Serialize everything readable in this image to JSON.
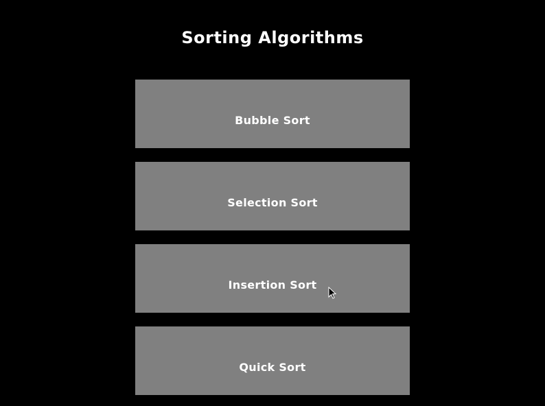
{
  "window": {
    "title": "Sorting Algorithms"
  },
  "menu": {
    "items": [
      {
        "label": "Bubble Sort"
      },
      {
        "label": "Selection Sort"
      },
      {
        "label": "Insertion Sort"
      },
      {
        "label": "Quick Sort"
      }
    ]
  },
  "colors": {
    "background": "#000000",
    "button": "#808080",
    "text": "#ffffff"
  },
  "icons": {
    "cursor": "mouse-pointer-icon"
  }
}
